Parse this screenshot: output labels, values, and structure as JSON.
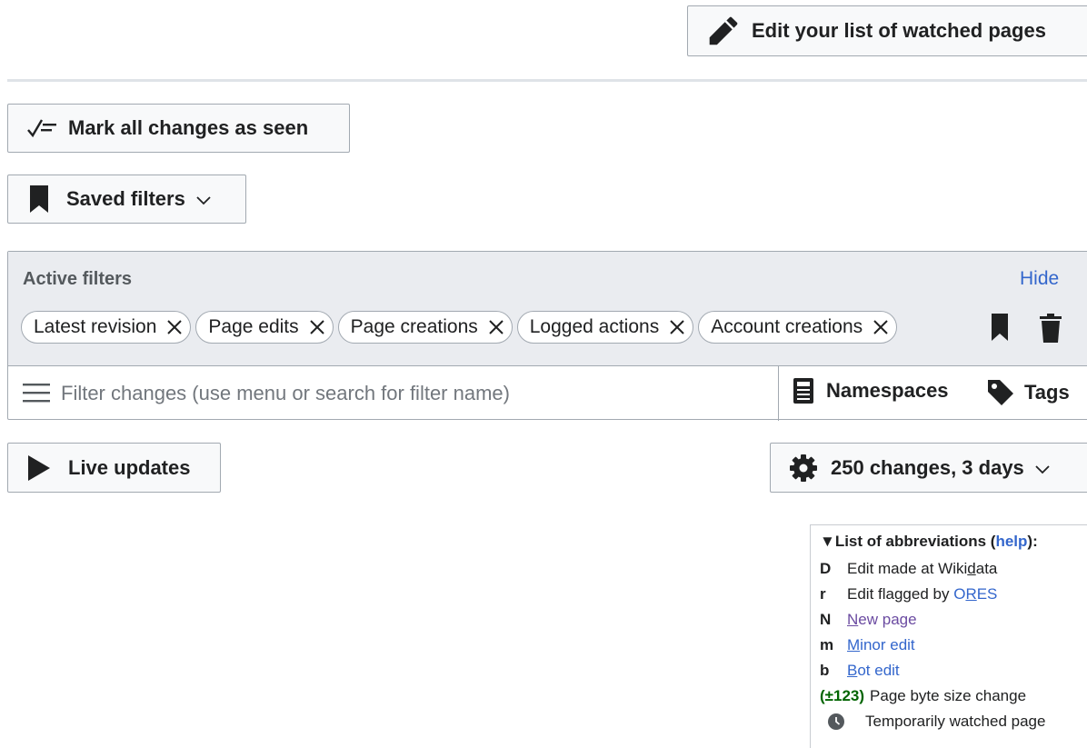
{
  "header": {
    "edit_watchlist_label": "Edit your list of watched pages"
  },
  "actions": {
    "mark_all_label": "Mark all changes as seen",
    "saved_filters_label": "Saved filters"
  },
  "filters": {
    "active_title": "Active filters",
    "hide_label": "Hide",
    "chips": [
      {
        "label": "Latest revision"
      },
      {
        "label": "Page edits"
      },
      {
        "label": "Page creations"
      },
      {
        "label": "Logged actions"
      },
      {
        "label": "Account creations"
      }
    ],
    "search_placeholder": "Filter changes (use menu or search for filter name)",
    "namespaces_label": "Namespaces",
    "tags_label": "Tags"
  },
  "controls": {
    "live_updates_label": "Live updates",
    "period_label": "250 changes, 3 days"
  },
  "legend": {
    "title_prefix": "List of abbreviations (",
    "help_label": "help",
    "title_suffix": "):",
    "rows": [
      {
        "abbr": "D",
        "desc_pre": "Edit made at Wiki",
        "desc_ul": "d",
        "desc_post": "ata"
      },
      {
        "abbr": "r",
        "desc": "Edit flagged by ",
        "link_pre": "O",
        "link_ul": "R",
        "link_post": "ES"
      },
      {
        "abbr": "N",
        "link_ul": "N",
        "link_post": "ew page"
      },
      {
        "abbr": "m",
        "link_ul": "M",
        "link_post": "inor edit"
      },
      {
        "abbr": "b",
        "link_ul": "B",
        "link_post": "ot edit"
      },
      {
        "size": "(±123)",
        "desc": "Page byte size change"
      },
      {
        "desc": "Temporarily watched page",
        "icon": "clock-icon"
      }
    ]
  },
  "colors": {
    "accent": "#3366cc",
    "visited": "#6b4ba1",
    "size_positive": "#006400",
    "panel_bg": "#eaecf0",
    "border": "#a2a9b1"
  }
}
